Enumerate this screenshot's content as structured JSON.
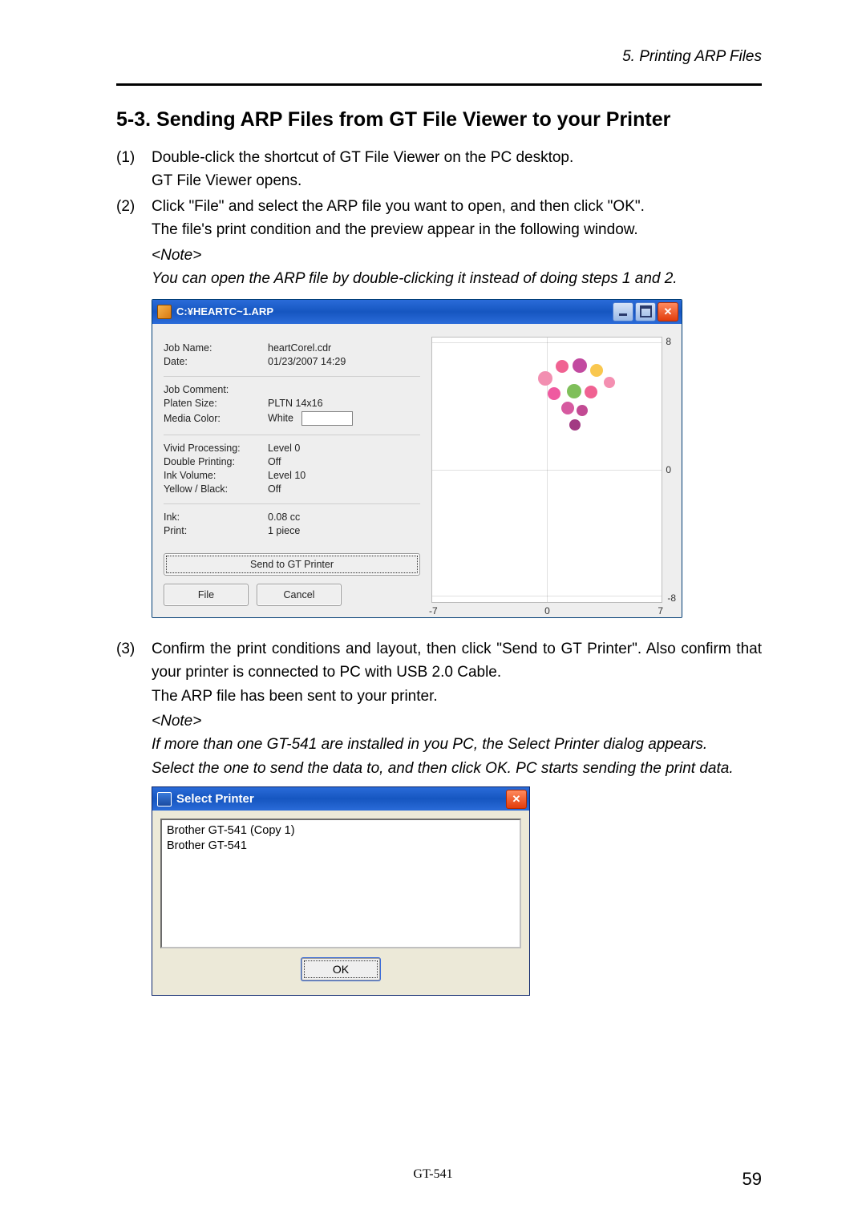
{
  "header": {
    "chapter": "5. Printing ARP Files"
  },
  "section": {
    "heading": "5-3. Sending ARP Files from GT File Viewer to your Printer"
  },
  "steps": {
    "s1": {
      "num": "(1)",
      "l1": "Double-click the shortcut of GT File Viewer on the PC desktop.",
      "l2": "GT File Viewer opens."
    },
    "s2": {
      "num": "(2)",
      "l1": "Click \"File\" and select the ARP file you want to open, and then click \"OK\".",
      "l2": "The file's print condition and the preview appear in the following window."
    },
    "note1": {
      "label": "<Note>",
      "body": "You can open the ARP file by double-clicking it instead of doing steps 1 and 2."
    },
    "s3": {
      "num": "(3)",
      "l1": "Confirm the print conditions and layout, then click \"Send to GT Printer\". Also confirm that your printer is connected to PC with USB 2.0 Cable.",
      "l2": "The ARP file has been sent to your printer."
    },
    "note2": {
      "label": "<Note>",
      "l1": "If more than one GT-541 are installed in you PC, the Select Printer dialog appears.",
      "l2": "Select the one to send the data to, and then click OK. PC starts sending the print data."
    }
  },
  "fileviewer": {
    "title": "C:¥HEARTC~1.ARP",
    "labels": {
      "jobname": "Job Name:",
      "date": "Date:",
      "jobcomment": "Job Comment:",
      "platen": "Platen Size:",
      "mediacolor": "Media Color:",
      "vivid": "Vivid Processing:",
      "double": "Double Printing:",
      "inkvol": "Ink Volume:",
      "yb": "Yellow / Black:",
      "ink": "Ink:",
      "print": "Print:"
    },
    "values": {
      "jobname": "heartCorel.cdr",
      "date": "01/23/2007 14:29",
      "jobcomment": "",
      "platen": "PLTN 14x16",
      "mediacolor": "White",
      "vivid": "Level 0",
      "double": "Off",
      "inkvol": "Level 10",
      "yb": "Off",
      "ink": "0.08 cc",
      "print": "1 piece"
    },
    "buttons": {
      "send": "Send to GT Printer",
      "file": "File",
      "cancel": "Cancel"
    },
    "axis": {
      "x_min": "-7",
      "x_mid": "0",
      "x_max": "7",
      "y_top": "8",
      "y_mid": "0",
      "y_bot": "-8"
    }
  },
  "selectprinter": {
    "title": "Select Printer",
    "items": [
      "Brother GT-541 (Copy 1)",
      "Brother GT-541"
    ],
    "ok": "OK"
  },
  "footer": {
    "model": "GT-541",
    "page": "59"
  }
}
